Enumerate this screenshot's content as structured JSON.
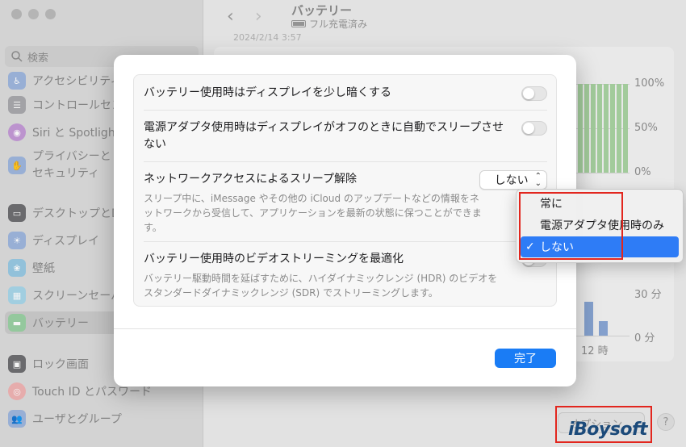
{
  "window": {
    "title": "バッテリー",
    "subtitle": "フル充電済み",
    "date_fragment": "2024/2/14 3:57",
    "options_label": "オプション...",
    "help_label": "?"
  },
  "search": {
    "placeholder": "検索"
  },
  "sidebar": {
    "items": [
      {
        "label": "アクセシビリティ",
        "icon": "accessibility-icon",
        "color": "#3b7ddd"
      },
      {
        "label": "コントロールセンター",
        "icon": "control-center-icon",
        "color": "#8e8e93"
      },
      {
        "label": "Siri と Spotlight",
        "icon": "siri-icon",
        "color": "#b04fd6"
      },
      {
        "label": "プライバシーとセキュリティ",
        "icon": "hand-icon",
        "color": "#3b7ddd"
      },
      {
        "label": "デスクトップとDock",
        "icon": "desktop-icon",
        "color": "#3a3a3c"
      },
      {
        "label": "ディスプレイ",
        "icon": "display-icon",
        "color": "#3b7ddd"
      },
      {
        "label": "壁紙",
        "icon": "wallpaper-icon",
        "color": "#34aadc"
      },
      {
        "label": "スクリーンセーバ",
        "icon": "screensaver-icon",
        "color": "#5ac8fa"
      },
      {
        "label": "バッテリー",
        "icon": "battery-icon",
        "color": "#34c759"
      },
      {
        "label": "ロック画面",
        "icon": "lock-screen-icon",
        "color": "#3a3a3c"
      },
      {
        "label": "Touch ID とパスワード",
        "icon": "fingerprint-icon",
        "color": "#ff6b6b"
      },
      {
        "label": "ユーザとグループ",
        "icon": "users-icon",
        "color": "#3b7ddd"
      }
    ]
  },
  "chart": {
    "pct_labels": [
      "100%",
      "50%",
      "0%"
    ],
    "time_labels": [
      "30 分",
      "0 分"
    ],
    "hour_label": "12 時"
  },
  "sheet": {
    "rows": [
      {
        "title": "バッテリー使用時はディスプレイを少し暗くする",
        "control": "toggle",
        "on": false
      },
      {
        "title": "電源アダプタ使用時はディスプレイがオフのときに自動でスリープさせない",
        "control": "toggle",
        "on": false
      },
      {
        "title": "ネットワークアクセスによるスリープ解除",
        "desc": "スリープ中に、iMessage やその他の iCloud のアップデートなどの情報をネットワークから受信して、アプリケーションを最新の状態に保つことができます。",
        "control": "popup",
        "value": "しない"
      },
      {
        "title": "バッテリー使用時のビデオストリーミングを最適化",
        "desc": "バッテリー駆動時間を延ばすために、ハイダイナミックレンジ (HDR) のビデオをスタンダードダイナミックレンジ (SDR) でストリーミングします。",
        "control": "toggle",
        "on": false
      }
    ],
    "done_label": "完了"
  },
  "menu": {
    "items": [
      {
        "label": "常に",
        "selected": false
      },
      {
        "label": "電源アダプタ使用時のみ",
        "selected": false
      },
      {
        "label": "しない",
        "selected": true
      }
    ],
    "check": "✓"
  },
  "watermark": "iBoysoft",
  "colors": {
    "accent": "#1a7cf5",
    "highlight": "#e2261e",
    "menu_selected": "#2e7cf6"
  }
}
